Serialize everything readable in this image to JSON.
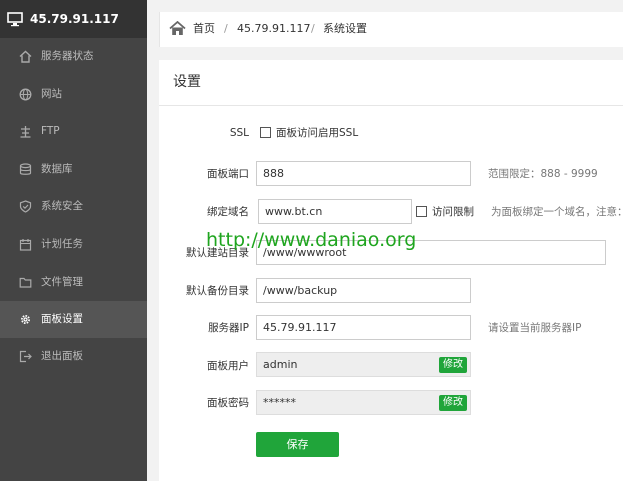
{
  "sidebar": {
    "server_ip": "45.79.91.117",
    "items": [
      {
        "label": "服务器状态",
        "icon": "home-icon"
      },
      {
        "label": "网站",
        "icon": "globe-icon"
      },
      {
        "label": "FTP",
        "icon": "ftp-icon"
      },
      {
        "label": "数据库",
        "icon": "database-icon"
      },
      {
        "label": "系统安全",
        "icon": "shield-icon"
      },
      {
        "label": "计划任务",
        "icon": "calendar-icon"
      },
      {
        "label": "文件管理",
        "icon": "folder-icon"
      },
      {
        "label": "面板设置",
        "icon": "gear-icon",
        "active": true
      },
      {
        "label": "退出面板",
        "icon": "logout-icon"
      }
    ]
  },
  "breadcrumb": {
    "home": "首页",
    "sep": "/",
    "server": "45.79.91.117",
    "current": "系统设置"
  },
  "panel": {
    "title": "设置",
    "ssl_label": "SSL",
    "ssl_checkbox_label": "面板访问启用SSL",
    "port_label": "面板端口",
    "port_value": "888",
    "port_hint": "范围限定：888 - 9999",
    "domain_label": "绑定域名",
    "domain_value": "www.bt.cn",
    "access_limit_label": "访问限制",
    "domain_hint": "为面板绑定一个域名，注意：",
    "site_dir_label": "默认建站目录",
    "site_dir_value": "/www/wwwroot",
    "backup_dir_label": "默认备份目录",
    "backup_dir_value": "/www/backup",
    "server_ip_label": "服务器IP",
    "server_ip_value": "45.79.91.117",
    "server_ip_hint": "请设置当前服务器IP",
    "user_label": "面板用户",
    "user_value": "admin",
    "user_edit": "修改",
    "password_label": "面板密码",
    "password_value": "******",
    "password_edit": "修改",
    "save": "保存"
  },
  "watermark": "http://www.daniao.org",
  "colors": {
    "accent": "#20a53a",
    "sidebar": "#444444",
    "sidebar_header": "#333333",
    "watermark": "#1fa51f"
  }
}
